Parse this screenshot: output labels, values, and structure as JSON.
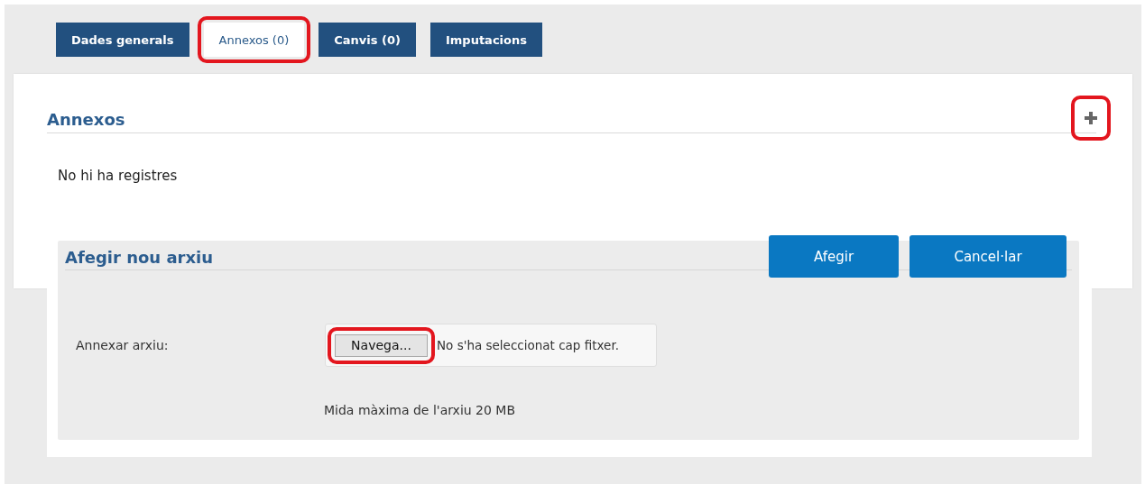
{
  "tabs": [
    {
      "label": "Dades generals",
      "selected": false,
      "highlighted": false
    },
    {
      "label": "Annexos (0)",
      "selected": true,
      "highlighted": true
    },
    {
      "label": "Canvis (0)",
      "selected": false,
      "highlighted": false
    },
    {
      "label": "Imputacions",
      "selected": false,
      "highlighted": false
    }
  ],
  "section": {
    "title": "Annexos",
    "add_button": {
      "highlighted": true
    },
    "empty_message": "No hi ha registres"
  },
  "dialog": {
    "title": "Afegir nou arxiu",
    "buttons": [
      "Afegir",
      "Cancel·lar"
    ],
    "field": {
      "label": "Annexar arxiu:",
      "browse_button": "Navega...",
      "browse_highlighted": true,
      "file_status": "No s'ha seleccionat cap fitxer."
    },
    "hint": "Mida màxima de l'arxiu 20 MB"
  }
}
